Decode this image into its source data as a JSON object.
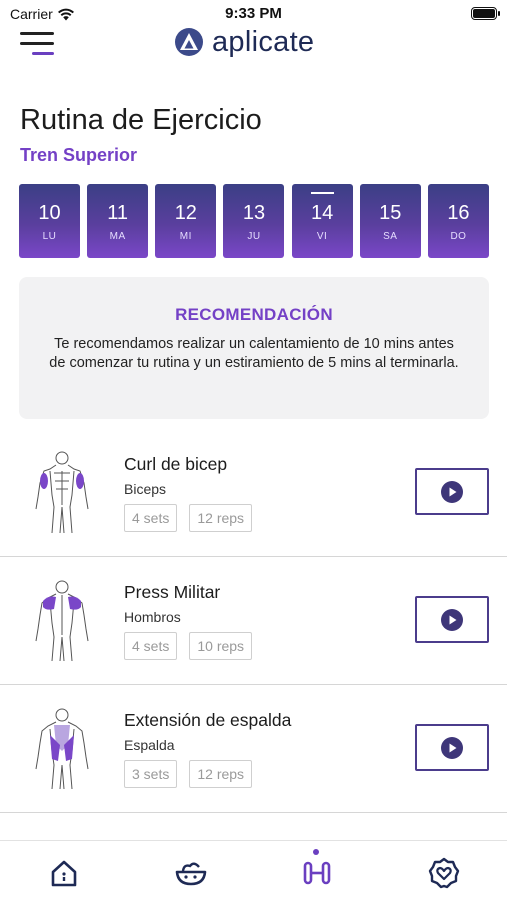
{
  "status_bar": {
    "carrier": "Carrier",
    "time": "9:33 PM"
  },
  "header": {
    "app_name": "aplicate",
    "logo_color": "#3c4a8a"
  },
  "page": {
    "title": "Rutina de Ejercicio",
    "subtitle": "Tren Superior"
  },
  "days": [
    {
      "num": "10",
      "dow": "LU",
      "selected": false
    },
    {
      "num": "11",
      "dow": "MA",
      "selected": false
    },
    {
      "num": "12",
      "dow": "MI",
      "selected": false
    },
    {
      "num": "13",
      "dow": "JU",
      "selected": false
    },
    {
      "num": "14",
      "dow": "VI",
      "selected": true
    },
    {
      "num": "15",
      "dow": "SA",
      "selected": false
    },
    {
      "num": "16",
      "dow": "DO",
      "selected": false
    }
  ],
  "recommendation": {
    "title": "RECOMENDACIÓN",
    "text": "Te recomendamos realizar un calentamiento de 10 mins antes de comenzar tu rutina y un estiramiento de 5 mins al terminarla."
  },
  "exercises": [
    {
      "name": "Curl de bicep",
      "muscle": "Biceps",
      "sets": "4 sets",
      "reps": "12 reps",
      "figure": "biceps-figure-icon"
    },
    {
      "name": "Press Militar",
      "muscle": "Hombros",
      "sets": "4 sets",
      "reps": "10 reps",
      "figure": "shoulders-figure-icon"
    },
    {
      "name": "Extensión de espalda",
      "muscle": "Espalda",
      "sets": "3 sets",
      "reps": "12 reps",
      "figure": "back-figure-icon"
    }
  ],
  "tabs": [
    {
      "icon": "home-icon",
      "active": false
    },
    {
      "icon": "nutrition-bowl-icon",
      "active": false
    },
    {
      "icon": "dumbbell-icon",
      "active": true
    },
    {
      "icon": "heart-badge-icon",
      "active": false
    }
  ],
  "colors": {
    "accent": "#7441c6",
    "day_gradient_top": "#3b3f85",
    "day_gradient_bottom": "#7a47c8",
    "play_border": "#4b3c8c"
  }
}
